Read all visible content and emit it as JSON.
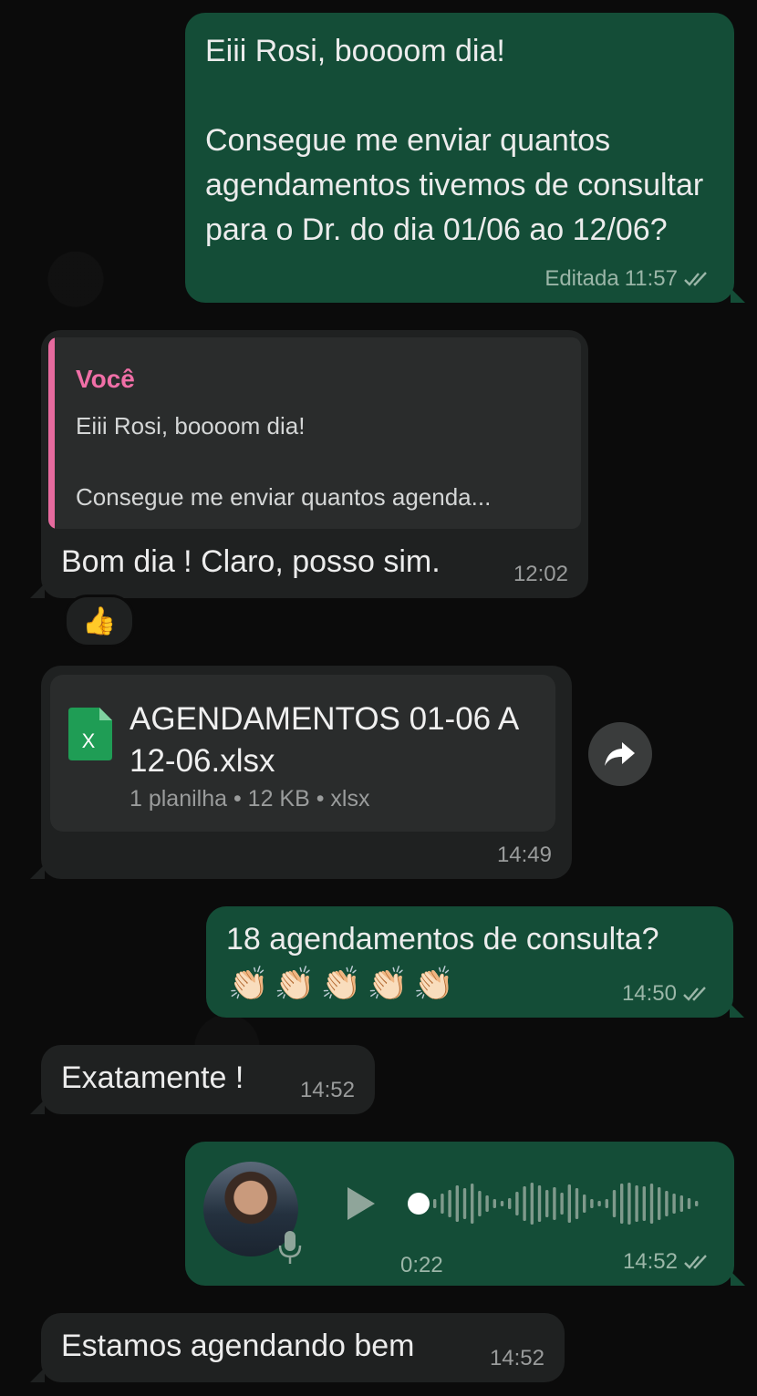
{
  "messages": {
    "m1": {
      "text": "Eiii Rosi, boooom dia!\n\nConsegue me enviar quantos agendamentos tivemos de consultar para o Dr. do dia 01/06 ao 12/06?",
      "edited_label": "Editada",
      "time": "11:57"
    },
    "m2": {
      "quote_author": "Você",
      "quote_text": "Eiii Rosi, boooom dia!\n\nConsegue me enviar quantos agenda...",
      "text": "Bom dia ! Claro, posso sim.",
      "time": "12:02",
      "reaction": "👍"
    },
    "m3": {
      "file_name": "AGENDAMENTOS 01-06 A 12-06.xlsx",
      "file_info": "1 planilha • 12 KB • xlsx",
      "time": "14:49"
    },
    "m4": {
      "text": "18 agendamentos de consulta?",
      "emojis": "👏🏻👏🏻👏🏻👏🏻👏🏻",
      "time": "14:50"
    },
    "m5": {
      "text": "Exatamente !",
      "time": "14:52"
    },
    "m6": {
      "duration": "0:22",
      "time": "14:52",
      "progress": 0
    },
    "m7": {
      "text": "Estamos agendando bem",
      "time": "14:52"
    }
  },
  "colors": {
    "outgoing_bubble": "#144d37",
    "incoming_bubble": "#1f2121",
    "quote_accent": "#f06fa7",
    "read_ticks": "#9bb6a8"
  },
  "icons": [
    "double-check-icon",
    "excel-file-icon",
    "forward-icon",
    "play-icon",
    "microphone-icon"
  ]
}
